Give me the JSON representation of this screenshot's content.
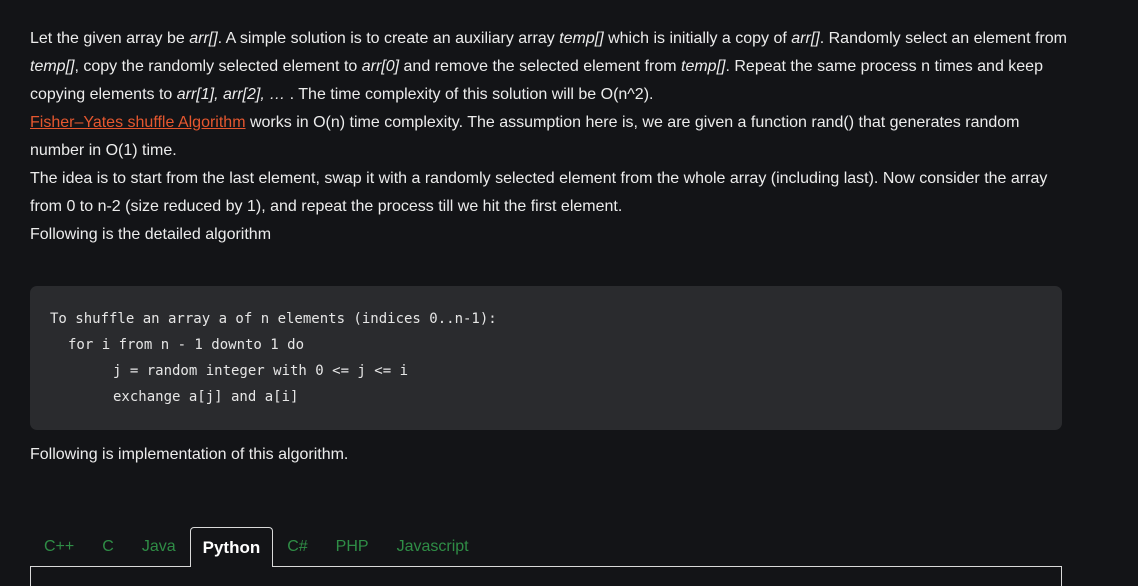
{
  "article": {
    "p1": {
      "s1": "Let the given array be ",
      "arr1": "arr[]",
      "s2": ". A simple solution is to create an auxiliary array ",
      "temp1": "temp[]",
      "s3": " which is initially a copy of ",
      "arr2": "arr[]",
      "s4": ". Randomly select an element from ",
      "temp2": "temp[]",
      "s5": ", copy the randomly selected element to ",
      "arr0": "arr[0]",
      "s6": " and remove the selected element from ",
      "temp3": "temp[]",
      "s7": ". Repeat the same process n times and keep copying elements to ",
      "arr_seq": "arr[1], arr[2], … ",
      "s8": ". The time complexity of this solution will be O(n^2)."
    },
    "p2": {
      "link": "Fisher–Yates shuffle Algorithm",
      "rest": " works in O(n) time complexity. The assumption here is, we are given a function rand() that generates random number in O(1) time."
    },
    "p3": "The idea is to start from the last element, swap it with a randomly selected element from the whole array (including last). Now consider the array from 0 to n-2 (size reduced by 1), and repeat the process till we hit the first element.",
    "p4": "Following is the detailed algorithm"
  },
  "code": {
    "line1": "To shuffle an array a of n elements (indices 0..n-1):",
    "line2": "for i from n - 1 downto 1 do",
    "line3": "j = random integer with 0 <= j <= i",
    "line4": "exchange a[j] and a[i]"
  },
  "implementation_text": "Following is implementation of this algorithm.",
  "tabs": [
    {
      "label": "C++",
      "active": false
    },
    {
      "label": "C",
      "active": false
    },
    {
      "label": "Java",
      "active": false
    },
    {
      "label": "Python",
      "active": true
    },
    {
      "label": "C#",
      "active": false
    },
    {
      "label": "PHP",
      "active": false
    },
    {
      "label": "Javascript",
      "active": false
    }
  ],
  "colors": {
    "background": "#131417",
    "link": "#e5572f",
    "tab_text": "#2f8d46",
    "code_background": "#2a2b2e"
  }
}
